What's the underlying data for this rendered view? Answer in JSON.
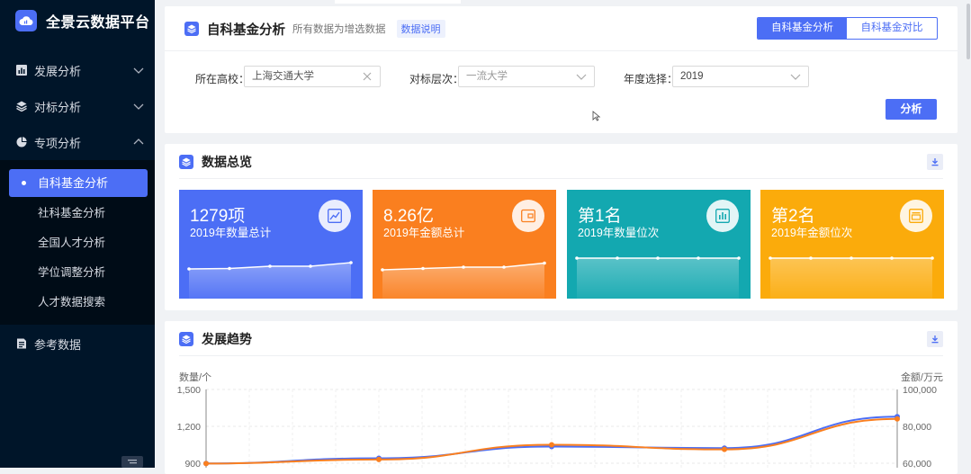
{
  "app": {
    "title": "全景云数据平台"
  },
  "sidebar": {
    "menus": [
      {
        "label": "发展分析",
        "icon": "bar-chart-icon",
        "expanded": false
      },
      {
        "label": "对标分析",
        "icon": "layers-icon",
        "expanded": false
      },
      {
        "label": "专项分析",
        "icon": "pie-chart-icon",
        "expanded": true
      },
      {
        "label": "参考数据",
        "icon": "document-icon"
      }
    ],
    "submenu": [
      {
        "label": "自科基金分析",
        "active": true
      },
      {
        "label": "社科基金分析"
      },
      {
        "label": "全国人才分析"
      },
      {
        "label": "学位调整分析"
      },
      {
        "label": "人才数据搜索"
      }
    ]
  },
  "filter_panel": {
    "title": "自科基金分析",
    "subtitle": "所有数据为增选数据",
    "badge": "数据说明",
    "toggle": {
      "options": [
        "自科基金分析",
        "自科基金对比"
      ],
      "active": 0
    },
    "fields": {
      "school": {
        "label": "所在高校：",
        "value": "上海交通大学"
      },
      "level": {
        "label": "对标层次：",
        "placeholder": "一流大学"
      },
      "year": {
        "label": "年度选择：",
        "value": "2019"
      }
    },
    "analyze_label": "分析"
  },
  "overview": {
    "title": "数据总览",
    "cards": [
      {
        "big": "1279项",
        "small": "2019年数量总计",
        "color": "#4c6ef5",
        "icon": "trend-icon"
      },
      {
        "big": "8.26亿",
        "small": "2019年金额总计",
        "color": "#fa7f1f",
        "icon": "wallet-icon"
      },
      {
        "big": "第1名",
        "small": "2019年数量位次",
        "color": "#13a8b0",
        "icon": "bar-chart-icon"
      },
      {
        "big": "第2名",
        "small": "2019年金额位次",
        "color": "#fbab0b",
        "icon": "archive-icon"
      }
    ]
  },
  "trend": {
    "title": "发展趋势",
    "chart_data": {
      "type": "line",
      "ylabel_left": "数量/个",
      "ylabel_right": "金额/万元",
      "y_ticks_left": [
        "1,500",
        "1,200",
        "900"
      ],
      "y_ticks_right": [
        "100,000",
        "80,000",
        "60,000"
      ],
      "ylim_left": [
        900,
        1500
      ],
      "ylim_right": [
        60000,
        100000
      ],
      "series": [
        {
          "color": "#4c6ef5",
          "axis": "left",
          "values": [
            898,
            940,
            1035,
            1023,
            1279
          ]
        },
        {
          "color": "#fa7f1f",
          "axis": "right",
          "values": [
            59800,
            62000,
            70000,
            67500,
            84000
          ]
        }
      ]
    }
  }
}
